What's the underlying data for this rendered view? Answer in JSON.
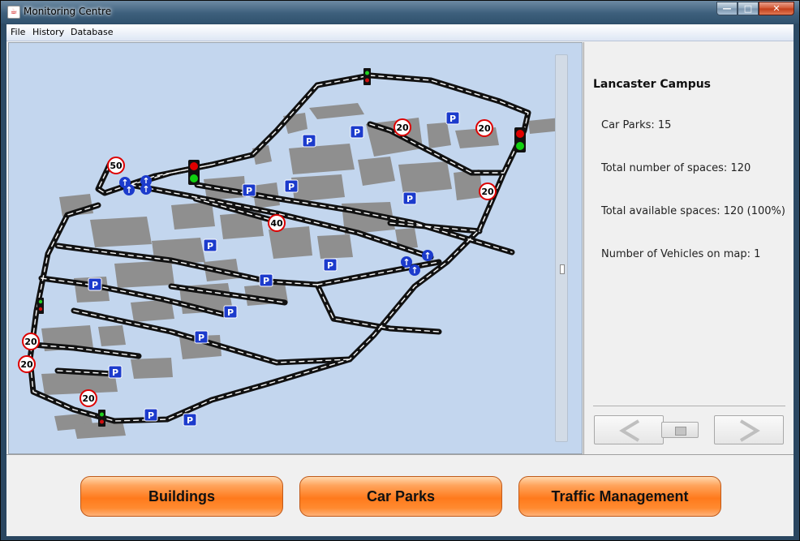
{
  "window": {
    "title": "Monitoring Centre",
    "icon": "java-cup-icon",
    "controls": {
      "minimize": "minimize-icon",
      "maximize": "maximize-icon",
      "close": "close-icon"
    }
  },
  "menu": [
    "File",
    "History",
    "Database"
  ],
  "map": {
    "speed_signs": [
      "20",
      "20",
      "20",
      "50",
      "40",
      "20",
      "20",
      "20",
      "20"
    ],
    "parking_label": "P",
    "colors": {
      "water": "#c3d6ee",
      "building": "#8f8f8f",
      "road": "#111111",
      "road_dash": "#ffffff"
    }
  },
  "info": {
    "title": "Lancaster Campus",
    "stats": [
      "Car Parks: 15",
      "Total number of spaces: 120",
      "Total available spaces: 120 (100%)",
      "Number of Vehicles on map: 1"
    ]
  },
  "nav": {
    "prev": "chevron-left-icon",
    "stop": "stop-icon",
    "next": "chevron-right-icon"
  },
  "buttons": [
    "Buildings",
    "Car Parks",
    "Traffic Management"
  ]
}
